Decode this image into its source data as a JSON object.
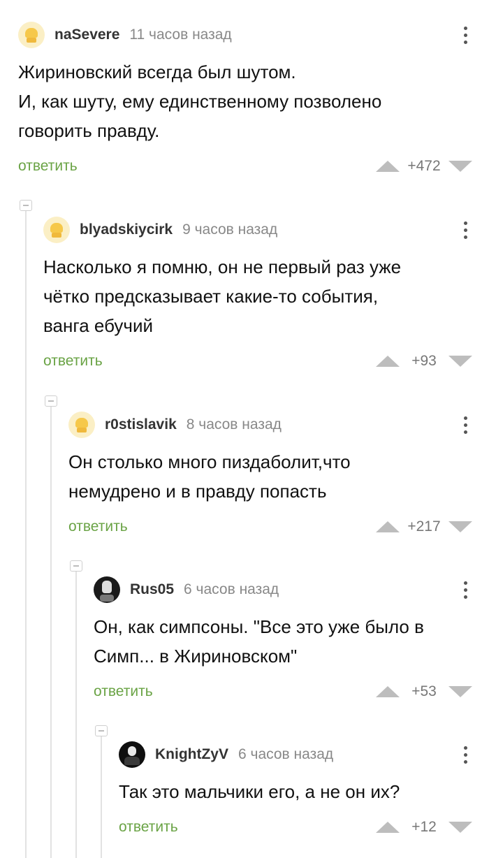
{
  "comments": [
    {
      "username": "naSevere",
      "time": "11 часов назад",
      "text_lines": [
        "Жириновский всегда был шутом.",
        "И, как шуту, ему единственному позволено",
        "говорить правду."
      ],
      "reply_label": "ответить",
      "rating": "+472",
      "avatar": "default-avatar-icon"
    },
    {
      "username": "blyadskiycirk",
      "time": "9 часов назад",
      "text_lines": [
        "Насколько я помню, он не первый раз уже",
        "чётко предсказывает какие-то события,",
        "ванга ебучий"
      ],
      "reply_label": "ответить",
      "rating": "+93",
      "avatar": "default-avatar-icon"
    },
    {
      "username": "r0stislavik",
      "time": "8 часов назад",
      "text_lines": [
        "Он столько много пиздаболит,что",
        "немудрено и в правду попасть"
      ],
      "reply_label": "ответить",
      "rating": "+217",
      "avatar": "default-avatar-icon"
    },
    {
      "username": "Rus05",
      "time": "6 часов назад",
      "text_lines": [
        "Он, как симпсоны. \"Все это уже было в",
        "Симп... в Жириновском\""
      ],
      "reply_label": "ответить",
      "rating": "+53",
      "avatar": "user-avatar-icon"
    },
    {
      "username": "KnightZyV",
      "time": "6 часов назад",
      "text_lines": [
        "Так это мальчики его, а не он их?"
      ],
      "reply_label": "ответить",
      "rating": "+12",
      "avatar": "joker-avatar-icon"
    }
  ]
}
